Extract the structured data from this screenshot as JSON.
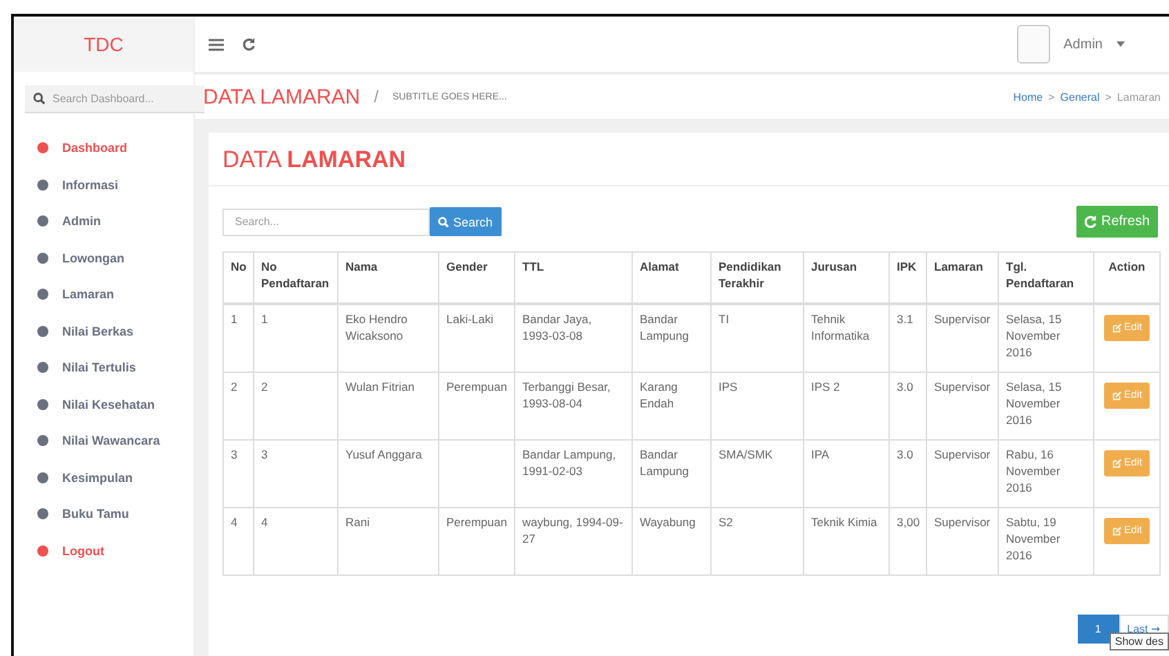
{
  "brand": "TDC",
  "topbar": {
    "user": "Admin"
  },
  "sidebar": {
    "search_placeholder": "Search Dashboard...",
    "items": [
      {
        "label": "Dashboard",
        "color": "#f05050"
      },
      {
        "label": "Informasi",
        "color": "#6b7080"
      },
      {
        "label": "Admin",
        "color": "#6b7080"
      },
      {
        "label": "Lowongan",
        "color": "#6b7080"
      },
      {
        "label": "Lamaran",
        "color": "#6b7080"
      },
      {
        "label": "Nilai Berkas",
        "color": "#6b7080"
      },
      {
        "label": "Nilai Tertulis",
        "color": "#6b7080"
      },
      {
        "label": "Nilai Kesehatan",
        "color": "#6b7080"
      },
      {
        "label": "Nilai Wawancara",
        "color": "#6b7080"
      },
      {
        "label": "Kesimpulan",
        "color": "#6b7080"
      },
      {
        "label": "Buku Tamu",
        "color": "#6b7080"
      },
      {
        "label": "Logout",
        "color": "#f05050"
      }
    ]
  },
  "header": {
    "title": "DATA LAMARAN",
    "separator": "/",
    "subtitle": "SUBTITLE GOES HERE...",
    "breadcrumb": [
      "Home",
      "General",
      "Lamaran"
    ],
    "breadcrumb_separator": ">"
  },
  "card": {
    "title": "DATA **LAMARAN**",
    "search_placeholder": "Search...",
    "search_button": "Search",
    "refresh_button": "Refresh"
  },
  "table": {
    "columns": [
      "No",
      "No Pendaftaran",
      "Nama",
      "Gender",
      "TTL",
      "Alamat",
      "Pendidikan Terakhir",
      "Jurusan",
      "IPK",
      "Lamaran",
      "Tgl. Pendaftaran",
      "Action"
    ],
    "rows": [
      {
        "cells": [
          "1",
          "1",
          "Eko Hendro Wicaksono",
          "Laki-Laki",
          "Bandar Jaya, 1993-03-08",
          "Bandar Lampung",
          "TI",
          "Tehnik Informatika",
          "3.1",
          "Supervisor",
          "Selasa, 15 November 2016"
        ],
        "action": "Edit"
      },
      {
        "cells": [
          "2",
          "2",
          "Wulan Fitrian",
          "Perempuan",
          "Terbanggi Besar, 1993-08-04",
          "Karang Endah",
          "IPS",
          "IPS 2",
          "3.0",
          "Supervisor",
          "Selasa, 15 November 2016"
        ],
        "action": "Edit"
      },
      {
        "cells": [
          "3",
          "3",
          "Yusuf Anggara",
          "",
          "Bandar Lampung, 1991-02-03",
          "Bandar Lampung",
          "SMA/SMK",
          "IPA",
          "3.0",
          "Supervisor",
          "Rabu, 16 November 2016"
        ],
        "action": "Edit"
      },
      {
        "cells": [
          "4",
          "4",
          "Rani",
          "Perempuan",
          "waybung, 1994-09-27",
          "Wayabung",
          "S2",
          "Teknik Kimia",
          "3,00",
          "Supervisor",
          "Sabtu, 19 November 2016"
        ],
        "action": "Edit"
      }
    ]
  },
  "pagination": {
    "pages": [
      {
        "label": "1",
        "selected": true
      }
    ],
    "last": "Last ➞"
  },
  "tooltip": "Show des"
}
